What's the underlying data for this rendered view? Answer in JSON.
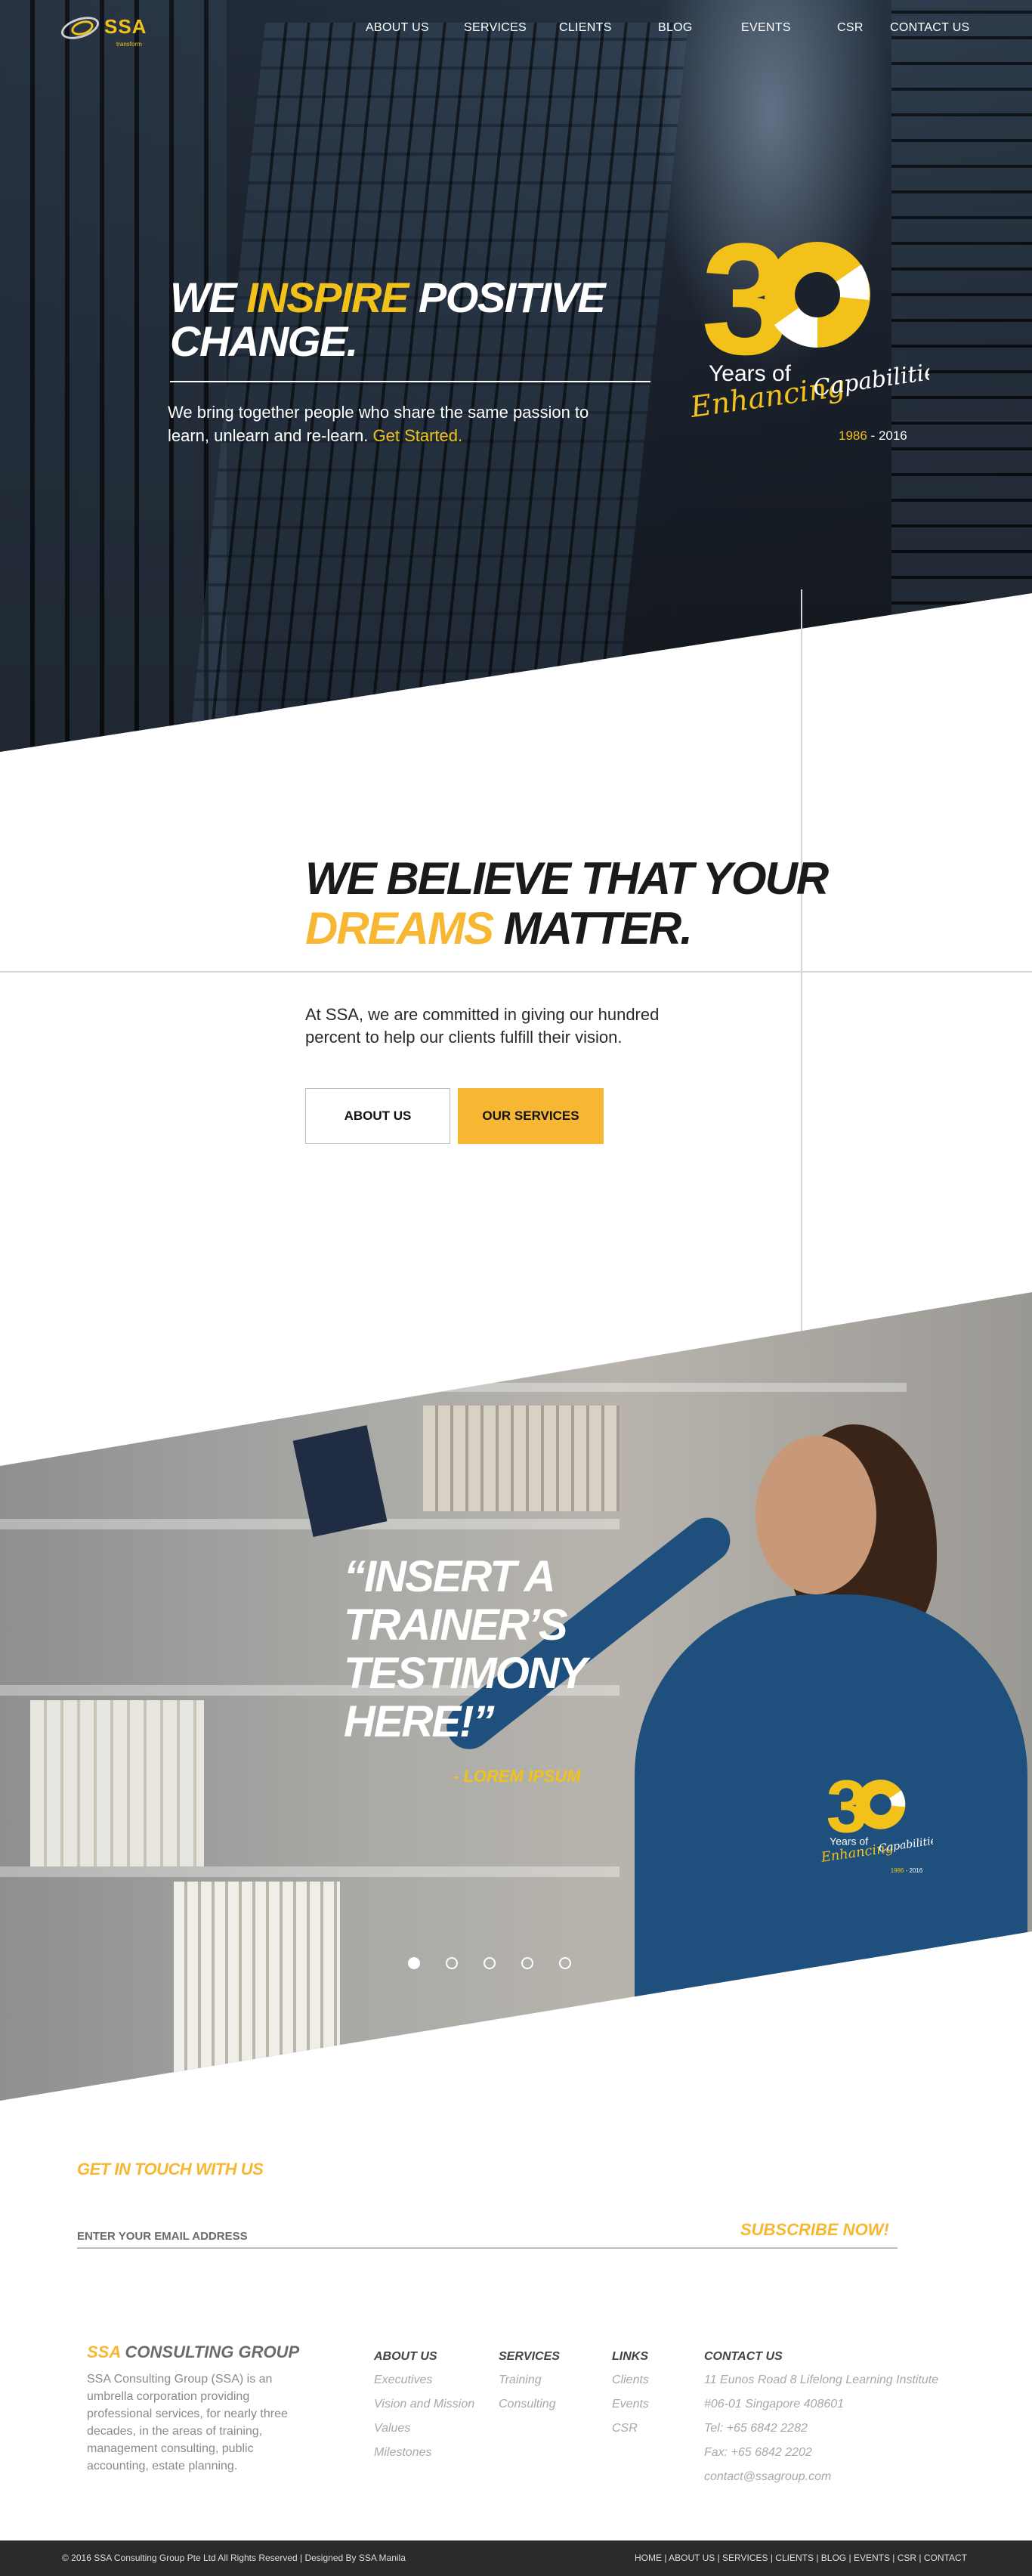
{
  "brand": {
    "name": "SSA",
    "tagline": "transform",
    "accent_color": "#f2c21b",
    "button_color": "#f7b733"
  },
  "nav": {
    "items": [
      {
        "label": "ABOUT US"
      },
      {
        "label": "SERVICES"
      },
      {
        "label": "CLIENTS"
      },
      {
        "label": "BLOG"
      },
      {
        "label": "EVENTS"
      },
      {
        "label": "CSR"
      },
      {
        "label": "CONTACT US"
      }
    ]
  },
  "hero": {
    "heading_pre": "WE ",
    "heading_accent": "INSPIRE",
    "heading_post": " POSITIVE",
    "heading_line2": "CHANGE.",
    "sub_line1": "We bring together people who share the same passion to",
    "sub_line2": "learn, unlearn and re-learn. ",
    "sub_link": "Get Started."
  },
  "badge": {
    "number_3": "3",
    "years_of": "Years of",
    "enhancing": "Enhancing",
    "capabilities": "Capabilities",
    "years_range_start": "1986",
    "years_range_sep": " - ",
    "years_range_end": "2016"
  },
  "believe": {
    "line1": "WE BELIEVE THAT YOUR",
    "accent": "DREAMS",
    "line2_post": " MATTER.",
    "sub_line1": "At SSA, we are committed in giving our hundred",
    "sub_line2": "percent to help our clients fulfill their vision.",
    "about_button": "ABOUT US",
    "services_button": "OUR SERVICES"
  },
  "testimony": {
    "quote_lines": [
      "“INSERT A",
      "TRAINER’S",
      "TESTIMONY",
      "HERE!”"
    ],
    "author": "- LOREM IPSUM",
    "slide_count": 5,
    "active_slide": 1
  },
  "subscribe": {
    "heading": "GET IN TOUCH WITH US",
    "placeholder": "ENTER YOUR EMAIL ADDRESS",
    "button": "SUBSCRIBE NOW!"
  },
  "footer": {
    "title_accent": "SSA",
    "title_rest": " CONSULTING GROUP",
    "description": "SSA Consulting Group (SSA) is an umbrella corporation providing professional services, for nearly three decades, in the areas of training, management consulting, public accounting, estate planning.",
    "columns": [
      {
        "heading": "ABOUT US",
        "items": [
          "Executives",
          "Vision and Mission",
          "Values",
          "Milestones"
        ]
      },
      {
        "heading": "SERVICES",
        "items": [
          "Training",
          "Consulting"
        ]
      },
      {
        "heading": "LINKS",
        "items": [
          "Clients",
          "Events",
          "CSR"
        ]
      },
      {
        "heading": "CONTACT US",
        "items": [
          "11 Eunos Road 8 Lifelong Learning Institute",
          "#06-01 Singapore 408601",
          "Tel: +65 6842 2282",
          "Fax: +65 6842 2202",
          "contact@ssagroup.com"
        ]
      }
    ],
    "copyright": "© 2016 SSA Consulting Group Pte Ltd All Rights Reserved | Designed By SSA Manila",
    "bottom_links": [
      "HOME",
      "ABOUT US",
      "SERVICES",
      "CLIENTS",
      "BLOG",
      "EVENTS",
      "CSR",
      "CONTACT"
    ]
  }
}
